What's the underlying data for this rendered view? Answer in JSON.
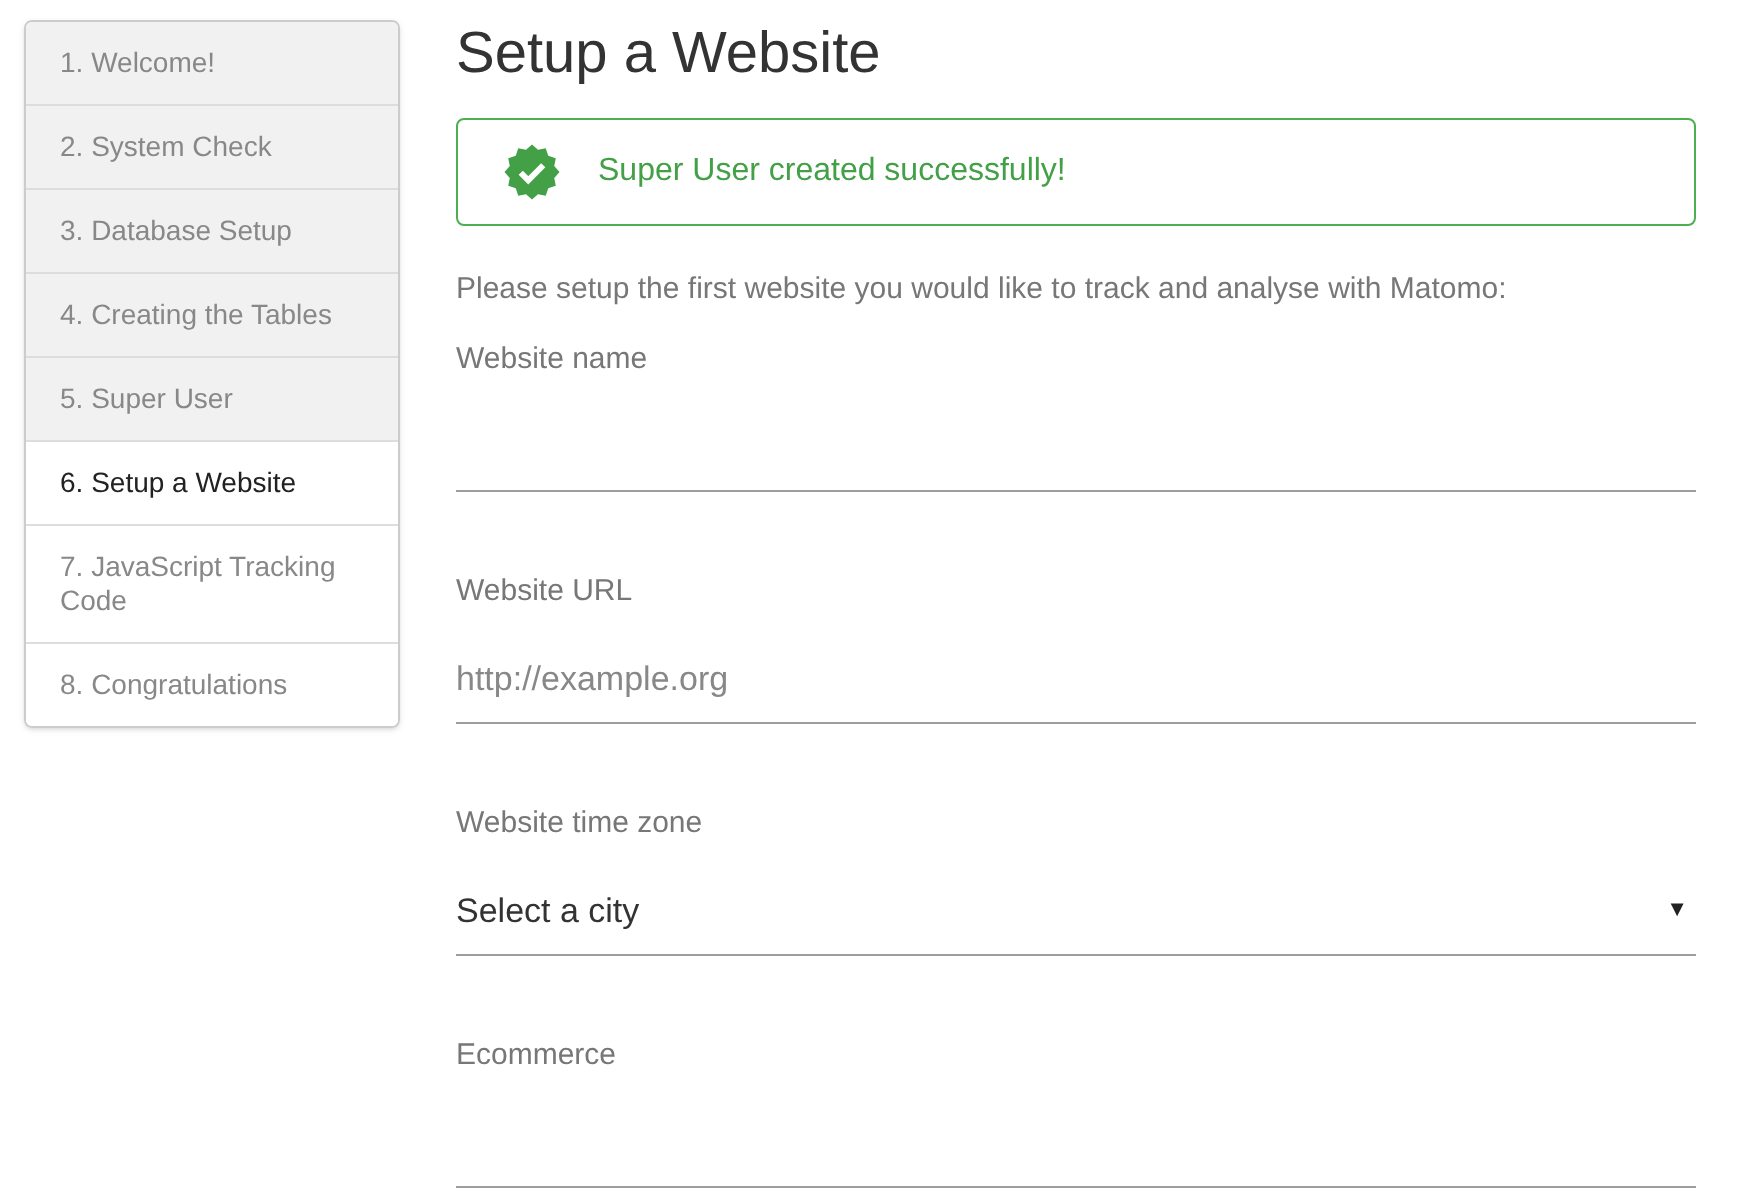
{
  "steps": [
    {
      "label": "1. Welcome!",
      "completed": true,
      "selected": false
    },
    {
      "label": "2. System Check",
      "completed": true,
      "selected": false
    },
    {
      "label": "3. Database Setup",
      "completed": true,
      "selected": false
    },
    {
      "label": "4. Creating the Tables",
      "completed": true,
      "selected": false
    },
    {
      "label": "5. Super User",
      "completed": true,
      "selected": false
    },
    {
      "label": "6. Setup a Website",
      "completed": false,
      "selected": true
    },
    {
      "label": "7. JavaScript Tracking Code",
      "completed": false,
      "selected": false
    },
    {
      "label": "8. Congratulations",
      "completed": false,
      "selected": false
    }
  ],
  "title": "Setup a Website",
  "alert": {
    "kind": "success",
    "message": "Super User created successfully!"
  },
  "intro": "Please setup the first website you would like to track and analyse with Matomo:",
  "fields": [
    {
      "kind": "text",
      "label": "Website name"
    },
    {
      "kind": "text",
      "label": "Website URL",
      "placeholder": "http://example.org"
    },
    {
      "kind": "select",
      "label": "Website time zone",
      "value": "Select a city",
      "arrow": "▼"
    },
    {
      "kind": "select",
      "label": "Ecommerce"
    }
  ]
}
